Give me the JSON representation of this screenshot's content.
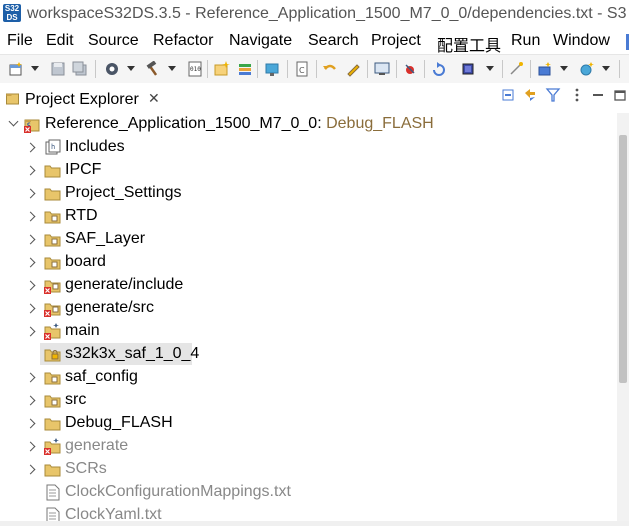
{
  "window": {
    "icon_text_top": "S32",
    "icon_text_bottom": "DS",
    "title": "workspaceS32DS.3.5 - Reference_Application_1500_M7_0_0/dependencies.txt - S3"
  },
  "menubar": {
    "items": [
      "File",
      "Edit",
      "Source",
      "Refactor",
      "Navigate",
      "Search",
      "Project",
      "配置工具",
      "Run",
      "Window"
    ]
  },
  "view": {
    "title": "Project Explorer",
    "close": "✕"
  },
  "tree": {
    "root": {
      "name": "Reference_Application_1500_M7_0_0",
      "sep": ":",
      "config": " Debug_FLASH"
    },
    "items": [
      {
        "label": "Includes",
        "icon": "includes-icon",
        "expandable": true,
        "dim": false
      },
      {
        "label": "IPCF",
        "icon": "folder-icon",
        "expandable": true,
        "dim": false
      },
      {
        "label": "Project_Settings",
        "icon": "folder-icon",
        "expandable": true,
        "dim": false
      },
      {
        "label": "RTD",
        "icon": "source-folder-icon",
        "expandable": true,
        "dim": false
      },
      {
        "label": "SAF_Layer",
        "icon": "source-folder-icon",
        "expandable": true,
        "dim": false
      },
      {
        "label": "board",
        "icon": "source-folder-icon",
        "expandable": true,
        "dim": false
      },
      {
        "label": "generate/include",
        "icon": "error-folder-icon",
        "expandable": true,
        "dim": false
      },
      {
        "label": "generate/src",
        "icon": "error-folder-icon",
        "expandable": true,
        "dim": false
      },
      {
        "label": "main",
        "icon": "error-source-folder-icon",
        "expandable": true,
        "dim": false
      },
      {
        "label": "s32k3x_saf_1_0_4",
        "icon": "locked-folder-icon",
        "expandable": false,
        "dim": false,
        "selected": true
      },
      {
        "label": "saf_config",
        "icon": "source-folder-icon",
        "expandable": true,
        "dim": false
      },
      {
        "label": "src",
        "icon": "source-folder-icon",
        "expandable": true,
        "dim": false
      },
      {
        "label": "Debug_FLASH",
        "icon": "folder-icon",
        "expandable": true,
        "dim": false
      },
      {
        "label": "generate",
        "icon": "error-source-folder-icon",
        "expandable": true,
        "dim": true
      },
      {
        "label": "SCRs",
        "icon": "folder-icon",
        "expandable": true,
        "dim": true
      },
      {
        "label": "ClockConfigurationMappings.txt",
        "icon": "text-file-icon",
        "expandable": false,
        "dim": true
      },
      {
        "label": "ClockYaml.txt",
        "icon": "text-file-icon",
        "expandable": false,
        "dim": true
      }
    ]
  },
  "colors": {
    "decoration": "#8a6d3b",
    "folder": "#e8c56a",
    "error": "#d9302b",
    "selection": "#e5e5e5"
  }
}
